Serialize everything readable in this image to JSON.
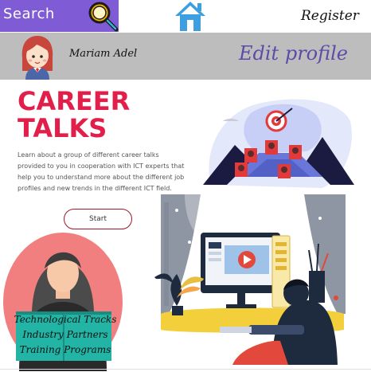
{
  "header": {
    "search_label": "Search",
    "search_icon": "magnifier-icon",
    "home_icon": "home-icon",
    "register_label": "Register"
  },
  "profile": {
    "user_name": "Mariam Adel",
    "edit_label": "Edit profile"
  },
  "career": {
    "title": "CAREER TALKS",
    "description": "Learn about a group of different career talks provided to you in cooperation with ICT experts that help you to understand more about the different job profiles and new trends in the different ICT field.",
    "start_label": "Start"
  },
  "tracks": {
    "items": [
      "Technological Tracks",
      "Industry Partners",
      "Training Programs"
    ]
  },
  "colors": {
    "accent_purple": "#7f5bd6",
    "title_red": "#e21f4b",
    "edit_profile": "#5e4aa8",
    "circle_pink": "#f27f7f",
    "teal": "#22b4a4"
  }
}
